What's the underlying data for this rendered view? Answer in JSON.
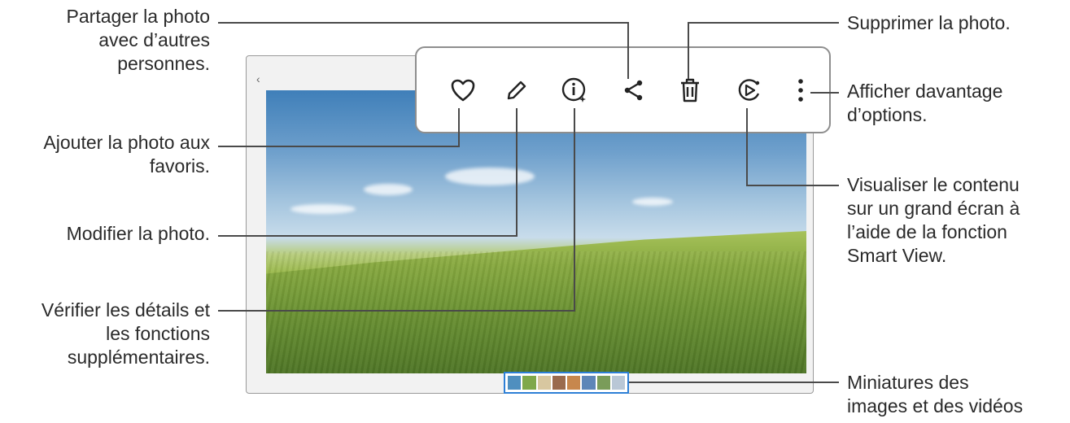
{
  "callouts": {
    "share": [
      "Partager la photo",
      "avec d’autres",
      "personnes."
    ],
    "favorite": [
      "Ajouter la photo aux",
      "favoris."
    ],
    "edit": [
      "Modifier la photo."
    ],
    "details": [
      "Vérifier les détails et",
      "les fonctions",
      "supplémentaires."
    ],
    "delete": [
      "Supprimer la photo."
    ],
    "more": [
      "Afficher davantage",
      "d’options."
    ],
    "smartview": [
      "Visualiser le contenu",
      "sur un grand écran à",
      "l’aide de la fonction",
      "Smart View."
    ],
    "thumbnails": [
      "Miniatures des",
      "images et des vidéos"
    ]
  },
  "toolbar_icons": [
    "heart-icon",
    "pencil-icon",
    "info-icon",
    "share-icon",
    "trash-icon",
    "smart-view-icon",
    "more-options-icon"
  ],
  "thumbnail_colors": [
    "#4f8fbf",
    "#7fa84a",
    "#d8c7a0",
    "#9a6b4e",
    "#c7874d",
    "#5e86b8",
    "#7a9c5a",
    "#b9c7d6"
  ],
  "colors": {
    "line": "#4a4a4a",
    "accent": "#2d7fd6",
    "frame": "#9a9a9a"
  },
  "back_glyph": "‹"
}
